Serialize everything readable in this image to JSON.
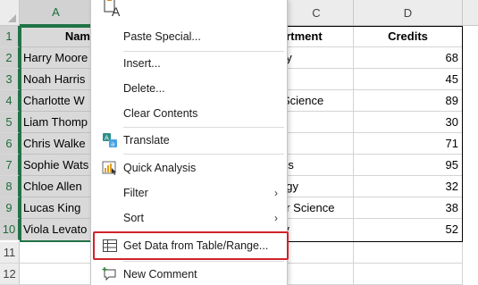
{
  "columns": [
    "A",
    "B",
    "C",
    "D"
  ],
  "rows": [
    "1",
    "2",
    "3",
    "4",
    "5",
    "6",
    "7",
    "8",
    "9",
    "10",
    "11",
    "12"
  ],
  "table": {
    "headers": {
      "name": "Name",
      "department": "Department",
      "credits": "Credits"
    },
    "name_visible": "Nam",
    "department_visible": "artment",
    "rows": [
      {
        "name": "Harry Moore",
        "dept": "gy",
        "credits": "68"
      },
      {
        "name": "Noah Harris",
        "dept": "",
        "credits": "45"
      },
      {
        "name": "Charlotte W",
        "dept": "Science",
        "credits": "89"
      },
      {
        "name": "Liam Thomp",
        "dept": "",
        "credits": "30"
      },
      {
        "name": "Chris Walke",
        "dept": "",
        "credits": "71"
      },
      {
        "name": "Sophie Wats",
        "dept": "ics",
        "credits": "95"
      },
      {
        "name": "Chloe Allen",
        "dept": "ogy",
        "credits": "32"
      },
      {
        "name": "Lucas King",
        "dept": "er Science",
        "credits": "38"
      },
      {
        "name": "Viola Levato",
        "dept": "ry",
        "credits": "52"
      }
    ]
  },
  "context_menu": {
    "items": [
      {
        "label": "Paste Special...",
        "icon": "paste-icon"
      },
      {
        "label": "Insert...",
        "icon": ""
      },
      {
        "label": "Delete...",
        "icon": ""
      },
      {
        "label": "Clear Contents",
        "icon": ""
      },
      {
        "label": "Translate",
        "icon": "translate-icon"
      },
      {
        "label": "Quick Analysis",
        "icon": "quick-analysis-icon"
      },
      {
        "label": "Filter",
        "icon": "",
        "submenu": "›"
      },
      {
        "label": "Sort",
        "icon": "",
        "submenu": "›"
      },
      {
        "label": "Get Data from Table/Range...",
        "icon": "table-icon"
      },
      {
        "label": "New Comment",
        "icon": "new-comment-icon"
      }
    ],
    "paste_option_letter": "A"
  },
  "colors": {
    "selection": "#217346",
    "highlight": "#d0232b"
  }
}
